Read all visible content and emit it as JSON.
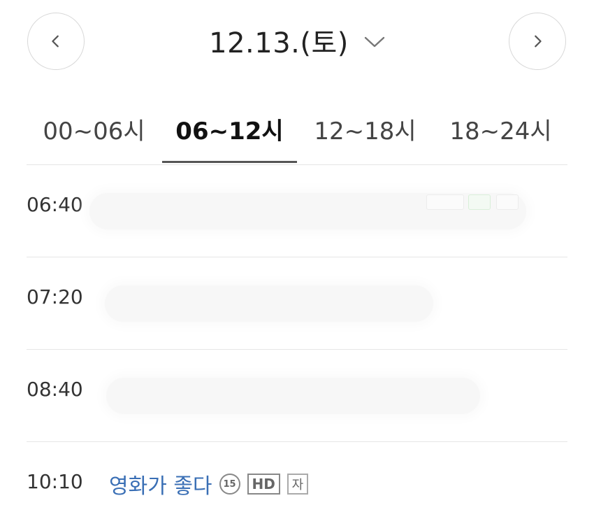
{
  "header": {
    "date": "12.13.(토)",
    "prev_icon": "chevron-left-icon",
    "next_icon": "chevron-right-icon",
    "dropdown_icon": "chevron-down-icon"
  },
  "tabs": [
    {
      "label": "00~06시",
      "active": false
    },
    {
      "label": "06~12시",
      "active": true
    },
    {
      "label": "12~18시",
      "active": false
    },
    {
      "label": "18~24시",
      "active": false
    }
  ],
  "schedule": [
    {
      "time": "06:40"
    },
    {
      "time": "07:20"
    },
    {
      "time": "08:40"
    },
    {
      "time": "10:10",
      "title": "영화가 좋다",
      "rating": "15",
      "hd": "HD",
      "subtitle": "자"
    }
  ],
  "colors": {
    "link": "#3a6fb5",
    "active_tab_underline": "#555555"
  }
}
